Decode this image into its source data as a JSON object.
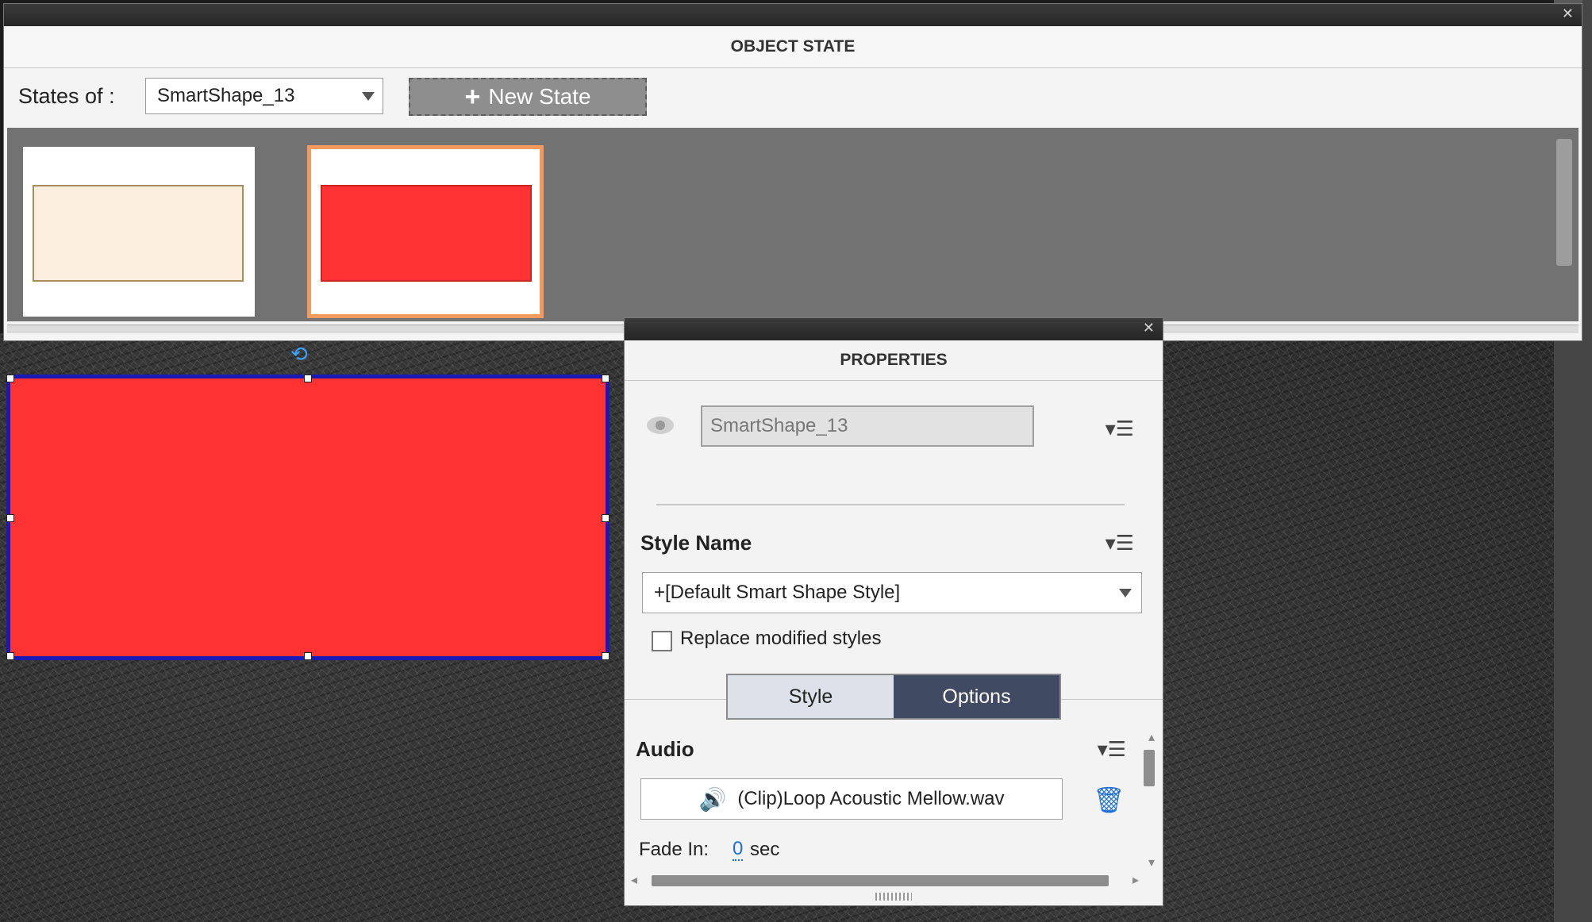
{
  "object_state": {
    "title": "OBJECT STATE",
    "states_of_label": "States of :",
    "selected_object": "SmartShape_13",
    "new_state_label": "New State",
    "thumbnails": [
      {
        "fill": "#fdefdf",
        "border": "#a78c5e",
        "selected": false
      },
      {
        "fill": "#ff3333",
        "border": "#f39a5f",
        "selected": true
      }
    ]
  },
  "canvas": {
    "selected_shape_fill": "#ff3333",
    "selection_color": "#1a1ab8"
  },
  "properties": {
    "title": "PROPERTIES",
    "name_value": "SmartShape_13",
    "style_name_heading": "Style Name",
    "style_value": "+[Default Smart Shape Style]",
    "replace_label": "Replace modified styles",
    "replace_checked": false,
    "tabs": [
      {
        "label": "Style",
        "active": false
      },
      {
        "label": "Options",
        "active": true
      }
    ],
    "audio_heading": "Audio",
    "audio_file": "(Clip)Loop Acoustic Mellow.wav",
    "fade_in_label": "Fade In:",
    "fade_in_value": "0",
    "fade_in_unit": "sec"
  },
  "icons": {
    "close": "close-icon",
    "plus": "plus-icon",
    "dropdown": "chevron-down-icon",
    "eye": "eye-icon",
    "menu": "panel-menu-icon",
    "speaker": "speaker-icon",
    "trash": "trash-icon"
  },
  "colors": {
    "accent_blue": "#1f6fd6",
    "active_tab": "#414a63",
    "selected_thumb_border": "#f39a5f"
  }
}
